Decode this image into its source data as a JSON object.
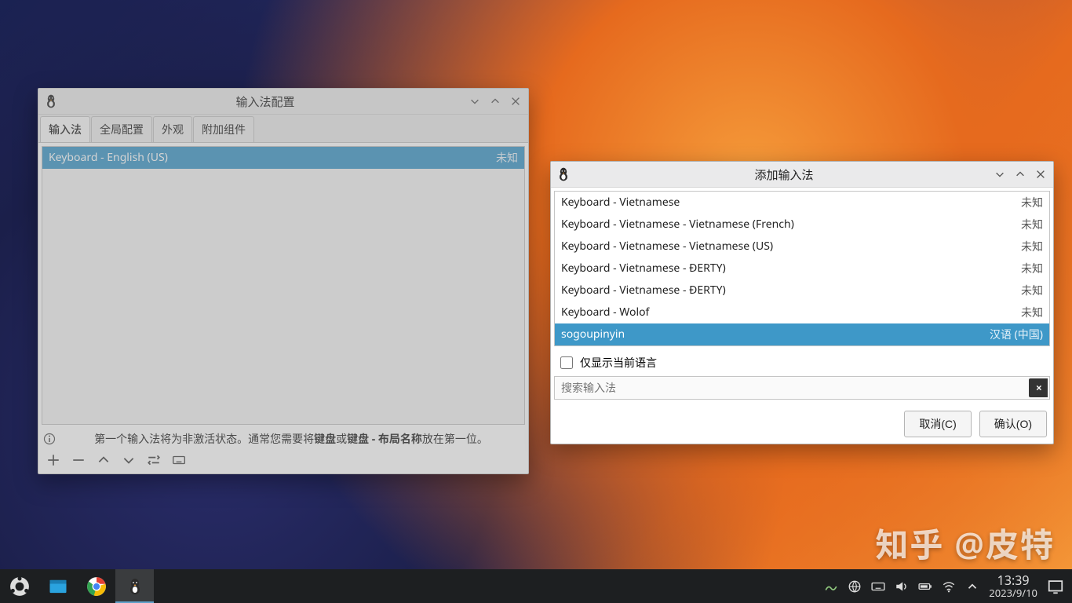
{
  "watermark": "知乎 @皮特",
  "config_window": {
    "title": "输入法配置",
    "tabs": [
      "输入法",
      "全局配置",
      "外观",
      "附加组件"
    ],
    "active_tab_index": 0,
    "list_items": [
      {
        "name": "Keyboard - English (US)",
        "status": "未知",
        "selected": true
      }
    ],
    "hint_prefix": "第一个输入法将为非激活状态。通常您需要将",
    "hint_bold1": "键盘",
    "hint_or": "或",
    "hint_bold2": "键盘 - 布局名称",
    "hint_suffix": "放在第一位。"
  },
  "add_window": {
    "title": "添加输入法",
    "items": [
      {
        "name": "Keyboard - Vietnamese",
        "status": "未知",
        "selected": false
      },
      {
        "name": "Keyboard - Vietnamese - Vietnamese (French)",
        "status": "未知",
        "selected": false
      },
      {
        "name": "Keyboard - Vietnamese - Vietnamese (US)",
        "status": "未知",
        "selected": false
      },
      {
        "name": "Keyboard - Vietnamese - ĐERTY)",
        "status": "未知",
        "selected": false
      },
      {
        "name": "Keyboard - Vietnamese - ĐERTY)",
        "status": "未知",
        "selected": false
      },
      {
        "name": "Keyboard - Wolof",
        "status": "未知",
        "selected": false
      },
      {
        "name": "sogoupinyin",
        "status": "汉语 (中国)",
        "selected": true
      }
    ],
    "checkbox_label": "仅显示当前语言",
    "checkbox_checked": false,
    "search_placeholder": "搜索输入法",
    "cancel_label": "取消(C)",
    "ok_label": "确认(O)"
  },
  "taskbar": {
    "time": "13:39",
    "date": "2023/9/10"
  }
}
